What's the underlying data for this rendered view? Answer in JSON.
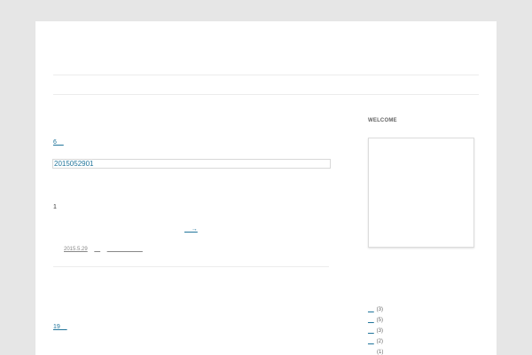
{
  "post": {
    "category_link": "6__",
    "title": "2015052901",
    "body_first_line": "1",
    "more_link": "__→",
    "meta": {
      "date": "2015.5.29",
      "author": "__",
      "filed": "__ ______ ___"
    }
  },
  "second_post": {
    "link": "19__"
  },
  "sidebar": {
    "widget_title": "WELCOME",
    "categories": [
      {
        "label": "__",
        "count": "(3)"
      },
      {
        "label": "__",
        "count": "(5)"
      },
      {
        "label": "__",
        "count": "(3)"
      },
      {
        "label": "__",
        "count": "(2)"
      },
      {
        "label": "",
        "count": "(1)"
      }
    ]
  },
  "colors": {
    "link": "#21759b",
    "background": "#e6e6e6",
    "page": "#ffffff"
  }
}
